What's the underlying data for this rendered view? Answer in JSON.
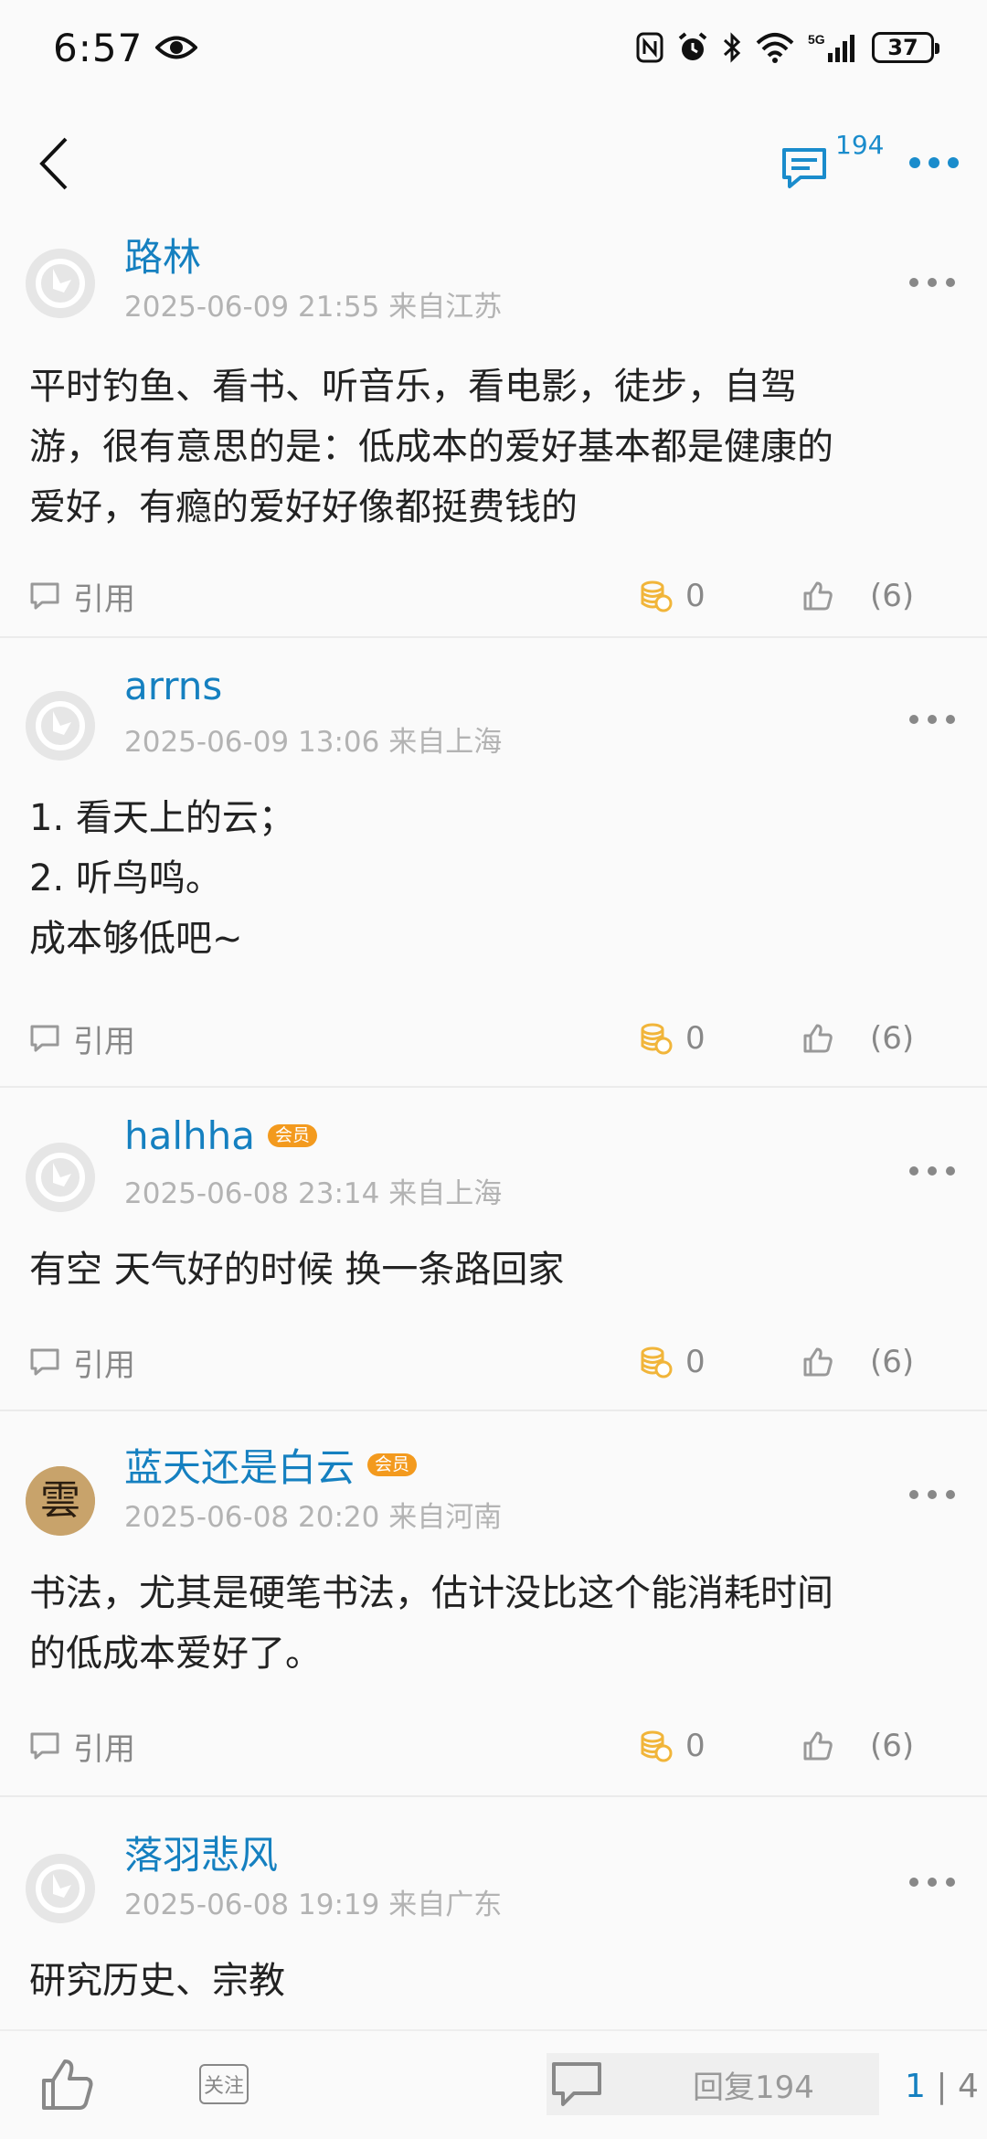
{
  "status_bar": {
    "time": "6:57",
    "battery": "37",
    "icons": [
      "eye-icon",
      "nfc-icon",
      "alarm-icon",
      "bluetooth-icon",
      "wifi-icon",
      "5g-signal-icon",
      "battery-icon"
    ]
  },
  "navbar": {
    "back_icon": "chevron-left-icon",
    "comment_count": "194",
    "more_icon": "more-dots-icon"
  },
  "posts": [
    {
      "author": "路林",
      "vip": "",
      "meta": "2025-06-09 21:55 来自江苏",
      "avatar": "default-avatar",
      "content_lines": [
        "平时钓鱼、看书、听音乐，看电影，徒步，自驾",
        "游，很有意思的是：低成本的爱好基本都是健康的",
        "爱好，有瘾的爱好好像都挺费钱的"
      ],
      "quote_label": "引用",
      "coins": "0",
      "likes": "(6)"
    },
    {
      "author": "arrns",
      "vip": "",
      "meta": "2025-06-09 13:06 来自上海",
      "avatar": "default-avatar",
      "content_lines": [
        "1. 看天上的云；",
        "2. 听鸟鸣。",
        "成本够低吧~"
      ],
      "quote_label": "引用",
      "coins": "0",
      "likes": "(6)"
    },
    {
      "author": "halhha",
      "vip": "会员",
      "meta": "2025-06-08 23:14 来自上海",
      "avatar": "default-avatar",
      "content_lines": [
        "有空 天气好的时候 换一条路回家"
      ],
      "quote_label": "引用",
      "coins": "0",
      "likes": "(6)"
    },
    {
      "author": "蓝天还是白云",
      "vip": "会员",
      "meta": "2025-06-08 20:20 来自河南",
      "avatar": "calligraphy-avatar",
      "avatar_char": "雲",
      "content_lines": [
        "书法，尤其是硬笔书法，估计没比这个能消耗时间",
        "的低成本爱好了。"
      ],
      "quote_label": "引用",
      "coins": "0",
      "likes": "(6)"
    },
    {
      "author": "落羽悲风",
      "vip": "",
      "meta": "2025-06-08 19:19 来自广东",
      "avatar": "default-avatar",
      "content_lines": [
        "研究历史、宗教"
      ],
      "quote_label": "",
      "coins": "",
      "likes": ""
    }
  ],
  "bottom_bar": {
    "follow_label": "关注",
    "reply_label": "回复194",
    "page_current": "1",
    "page_separator": "|",
    "page_total": "4"
  },
  "colors": {
    "accent": "#1580c0",
    "vip_badge": "#f39a1e",
    "coin": "#f1b53a",
    "muted": "#888888"
  }
}
